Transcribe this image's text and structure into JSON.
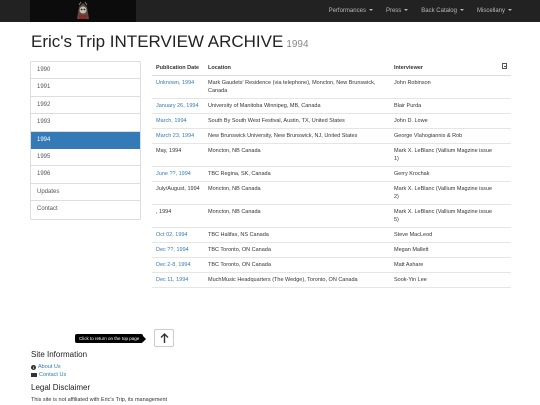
{
  "nav": {
    "items": [
      {
        "label": "Performances"
      },
      {
        "label": "Press"
      },
      {
        "label": "Back Catalog"
      },
      {
        "label": "Miscellany"
      }
    ]
  },
  "page": {
    "title": "Eric's Trip INTERVIEW ARCHIVE",
    "year": "1994"
  },
  "sidebar": {
    "items": [
      {
        "label": "1990"
      },
      {
        "label": "1991"
      },
      {
        "label": "1992"
      },
      {
        "label": "1993"
      },
      {
        "label": "1994",
        "active": true
      },
      {
        "label": "1995"
      },
      {
        "label": "1996"
      },
      {
        "label": "Updates"
      },
      {
        "label": "Contact"
      }
    ]
  },
  "table": {
    "headers": {
      "date": "Publication Date",
      "location": "Location",
      "interviewer": "Interviewer",
      "doc_icon": "document-icon"
    },
    "rows": [
      {
        "date": "Unknown, 1994",
        "link": true,
        "location": "Mark Gaudets' Residence (via telephone), Moncton, New Brunswick, Canada",
        "interviewer": "John Robinson"
      },
      {
        "date": "January 26, 1994",
        "link": true,
        "location": "University of Manitoba Winnipeg, MB, Canada",
        "interviewer": "Blair Purda"
      },
      {
        "date": "March, 1994",
        "link": true,
        "location": "South By South West Festival, Austin, TX, United States",
        "interviewer": "John D. Lowe"
      },
      {
        "date": "March 23, 1994",
        "link": true,
        "location": "New Brunswick University, New Brunswick, NJ, United States",
        "interviewer": "George Vlahogiannis & Rob"
      },
      {
        "date": "May, 1994",
        "link": false,
        "location": "Moncton, NB Canada",
        "interviewer": "Mark X. LeBlanc (Vallium Magzine issue 1)"
      },
      {
        "date": "June ??, 1994",
        "link": true,
        "location": "TBC Regina, SK, Canada",
        "interviewer": "Gerry Krochak"
      },
      {
        "date": "July/August, 1994",
        "link": false,
        "location": "Moncton, NB Canada",
        "interviewer": "Mark X. LeBlanc (Vallium Magzine issue 2)"
      },
      {
        "date": ", 1994",
        "link": false,
        "location": "Moncton, NB Canada",
        "interviewer": "Mark X. LeBlanc (Vallium Magzine issue 5)"
      },
      {
        "date": "Oct 02, 1994",
        "link": true,
        "location": "TBC Halifax, NS Canada",
        "interviewer": "Steve MacLeod"
      },
      {
        "date": "Dec ??, 1994",
        "link": true,
        "location": "TBC Toronto, ON Canada",
        "interviewer": "Megan Mallett"
      },
      {
        "date": "Dec 2-8, 1994",
        "link": true,
        "location": "TBC Toronto, ON Canada",
        "interviewer": "Matt Ashare"
      },
      {
        "date": "Dec 11, 1994",
        "link": true,
        "location": "MuchMusic Headquarters (The Wedge), Toronto, ON Canada",
        "interviewer": "Sook-Yin Lee"
      }
    ]
  },
  "back_to_top": {
    "tooltip": "Click to return on the top page"
  },
  "footer": {
    "site_info_heading": "Site Information",
    "about_label": "About Us",
    "contact_label": "Contact Us",
    "legal_heading": "Legal Disclaimer",
    "legal_text": "This site is not affiliated with Eric's Trip, its management"
  },
  "colors": {
    "accent": "#337ab7",
    "navbar": "#222222"
  }
}
